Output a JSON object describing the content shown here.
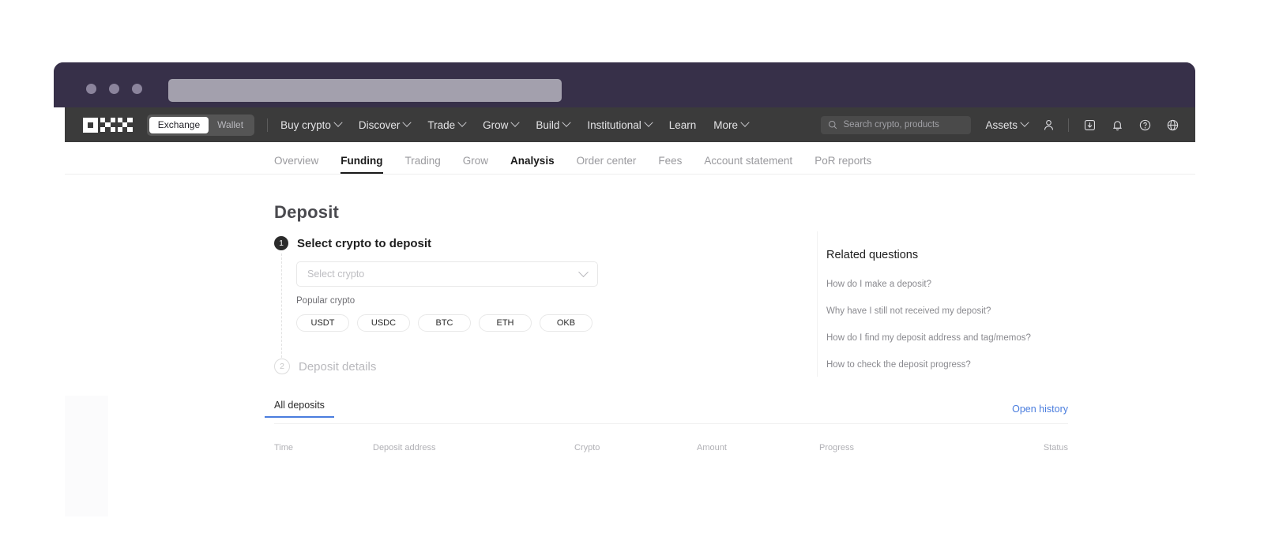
{
  "browser": {
    "dots": [
      "close",
      "minimize",
      "maximize"
    ],
    "address_bar_value": ""
  },
  "navbar": {
    "logo_name": "okx-logo",
    "toggle": {
      "active_label": "Exchange",
      "inactive_label": "Wallet"
    },
    "links": [
      {
        "label": "Buy crypto",
        "has_chevron": true
      },
      {
        "label": "Discover",
        "has_chevron": true
      },
      {
        "label": "Trade",
        "has_chevron": true
      },
      {
        "label": "Grow",
        "has_chevron": true
      },
      {
        "label": "Build",
        "has_chevron": true
      },
      {
        "label": "Institutional",
        "has_chevron": true
      },
      {
        "label": "Learn",
        "has_chevron": false
      },
      {
        "label": "More",
        "has_chevron": true
      }
    ],
    "search": {
      "placeholder": "Search crypto, products",
      "icon": "search-icon"
    },
    "assets_menu_label": "Assets",
    "icons": [
      "user-icon",
      "download-icon",
      "bell-icon",
      "help-circle-icon",
      "globe-icon"
    ]
  },
  "subnav": {
    "tabs": [
      {
        "label": "Overview",
        "state": "muted"
      },
      {
        "label": "Funding",
        "state": "active"
      },
      {
        "label": "Trading",
        "state": "muted"
      },
      {
        "label": "Grow",
        "state": "muted"
      },
      {
        "label": "Analysis",
        "state": "dark"
      },
      {
        "label": "Order center",
        "state": "muted"
      },
      {
        "label": "Fees",
        "state": "muted"
      },
      {
        "label": "Account statement",
        "state": "muted"
      },
      {
        "label": "PoR reports",
        "state": "muted"
      }
    ]
  },
  "main": {
    "page_title": "Deposit",
    "step1": {
      "number": "1",
      "title": "Select crypto to deposit"
    },
    "step2": {
      "number": "2",
      "title": "Deposit details"
    },
    "crypto_select": {
      "placeholder": "Select crypto",
      "value": "",
      "chevron_icon": "chevron-down-icon"
    },
    "popular_label": "Popular crypto",
    "popular_chips": [
      "USDT",
      "USDC",
      "BTC",
      "ETH",
      "OKB"
    ]
  },
  "related_questions": {
    "title": "Related questions",
    "items": [
      "How do I make a deposit?",
      "Why have I still not received my deposit?",
      "How do I find my deposit address and tag/memos?",
      "How to check the deposit progress?"
    ]
  },
  "deposits": {
    "tab_label": "All deposits",
    "open_history_label": "Open history",
    "columns": [
      "Time",
      "Deposit address",
      "Crypto",
      "Amount",
      "Progress",
      "Status"
    ],
    "rows": []
  },
  "colors": {
    "browser_chrome": "#373049",
    "navbar": "#3b3b3b",
    "accent_blue": "#4a7dde",
    "step_active": "#2b2b2b"
  }
}
